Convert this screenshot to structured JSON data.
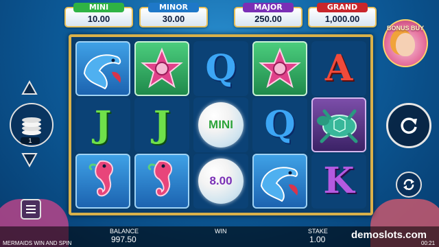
{
  "jackpots": [
    {
      "name": "MINI",
      "value": "10.00",
      "color": "#2fb344"
    },
    {
      "name": "MINOR",
      "value": "30.00",
      "color": "#1e78c8"
    },
    {
      "name": "MAJOR",
      "value": "250.00",
      "color": "#7a2fb6"
    },
    {
      "name": "GRAND",
      "value": "1,000.00",
      "color": "#c9262b"
    }
  ],
  "bonus_buy": {
    "label": "BONUS BUY"
  },
  "reels": [
    [
      "dolphin",
      "J",
      "seahorse"
    ],
    [
      "starfish",
      "J",
      "seahorse"
    ],
    [
      "Q",
      "MINI",
      "8.00"
    ],
    [
      "starfish",
      "Q",
      "dolphin"
    ],
    [
      "A",
      "turtle",
      "K"
    ]
  ],
  "bet_level": "1",
  "bottom_bar": {
    "balance_label": "BALANCE",
    "balance_value": "997.50",
    "win_label": "WIN",
    "stake_label": "STAKE",
    "stake_value": "1.00",
    "game_title": "MERMAIDS WIN AND SPIN",
    "watermark": "demoslots.com",
    "clock": "00:21"
  }
}
